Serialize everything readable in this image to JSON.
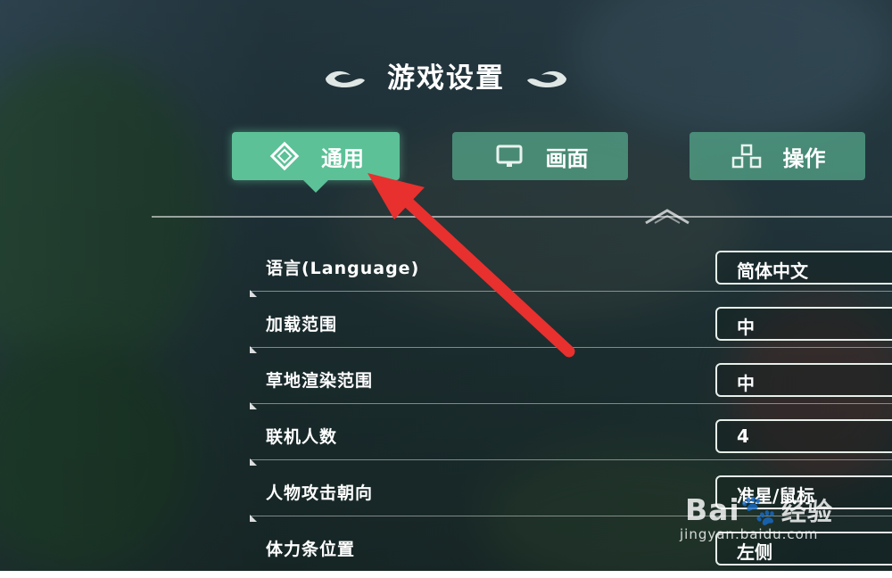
{
  "page": {
    "title": "游戏设置"
  },
  "tabs": [
    {
      "label": "通用",
      "icon": "diamond-settings-icon",
      "active": true
    },
    {
      "label": "画面",
      "icon": "monitor-icon",
      "active": false
    },
    {
      "label": "操作",
      "icon": "blocks-icon",
      "active": false
    }
  ],
  "settings": [
    {
      "label": "语言(Language)",
      "value": "简体中文"
    },
    {
      "label": "加载范围",
      "value": "中"
    },
    {
      "label": "草地渲染范围",
      "value": "中"
    },
    {
      "label": "联机人数",
      "value": "4"
    },
    {
      "label": "人物攻击朝向",
      "value": "准星/鼠标"
    },
    {
      "label": "体力条位置",
      "value": "左侧"
    }
  ],
  "annotation": {
    "type": "red-arrow",
    "target": "通用",
    "color": "#e8302e"
  },
  "watermark": {
    "brand": "Bai",
    "brand_cn": "经验",
    "url": "jingyan.baidu.com"
  },
  "colors": {
    "tab_active": "#5cc197",
    "tab_inactive": "#56aa8c",
    "arrow": "#e8302e"
  }
}
